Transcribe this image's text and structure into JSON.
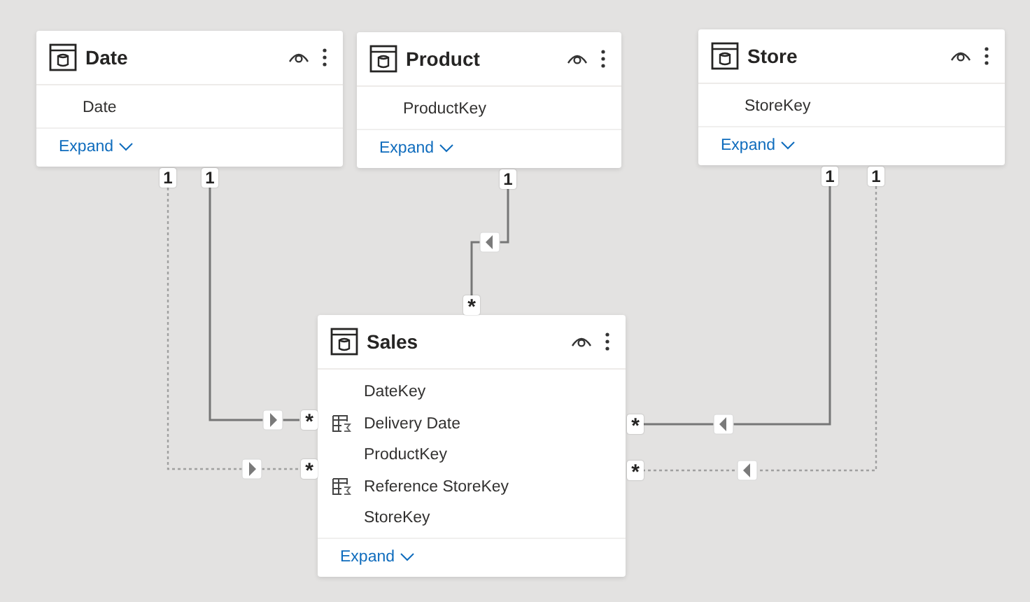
{
  "tables": [
    {
      "name": "Date",
      "fields": [
        {
          "name": "Date",
          "kind": "column"
        }
      ],
      "expand": "Expand"
    },
    {
      "name": "Product",
      "fields": [
        {
          "name": "ProductKey",
          "kind": "column"
        }
      ],
      "expand": "Expand"
    },
    {
      "name": "Store",
      "fields": [
        {
          "name": "StoreKey",
          "kind": "column"
        }
      ],
      "expand": "Expand"
    },
    {
      "name": "Sales",
      "fields": [
        {
          "name": "DateKey",
          "kind": "column"
        },
        {
          "name": "Delivery Date",
          "kind": "calculated"
        },
        {
          "name": "ProductKey",
          "kind": "column"
        },
        {
          "name": "Reference StoreKey",
          "kind": "calculated"
        },
        {
          "name": "StoreKey",
          "kind": "column"
        }
      ],
      "expand": "Expand"
    }
  ],
  "relationships": [
    {
      "one_end": "1",
      "many_end": "*",
      "active": false
    },
    {
      "one_end": "1",
      "many_end": "*",
      "active": true
    },
    {
      "one_end": "1",
      "many_end": "*",
      "active": true
    },
    {
      "one_end": "1",
      "many_end": "*",
      "active": true
    },
    {
      "one_end": "1",
      "many_end": "*",
      "active": false
    }
  ]
}
